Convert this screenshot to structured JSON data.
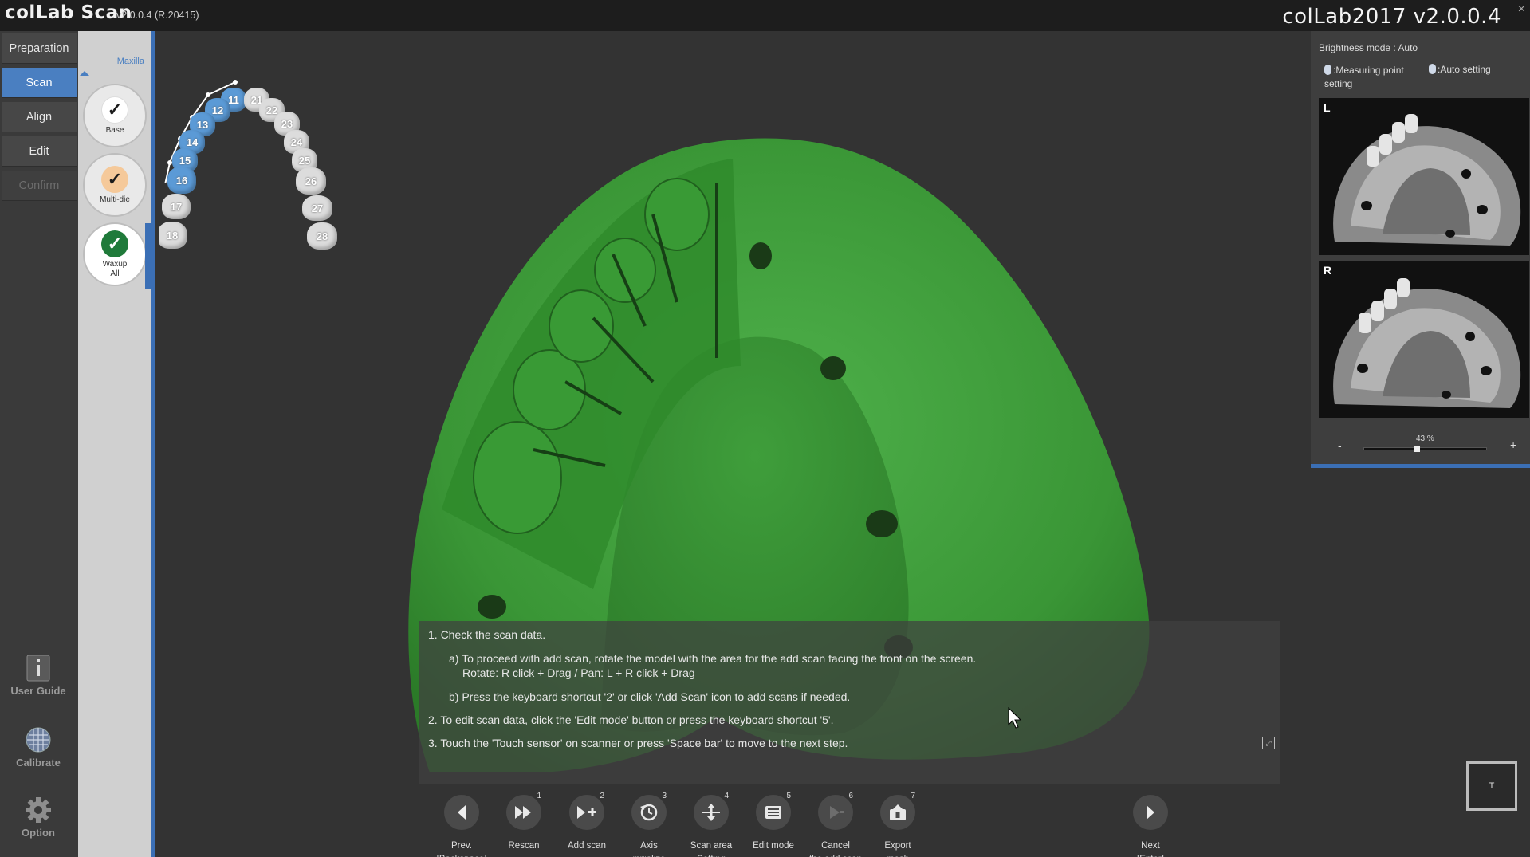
{
  "titlebar": {
    "app_name": "colLab Scan",
    "version": "v2.0.0.4 (R.20415)",
    "brand": "colLab2017 v2.0.0.4",
    "close": "×"
  },
  "leftnav": {
    "items": [
      {
        "label": "Preparation",
        "state": "normal"
      },
      {
        "label": "Scan",
        "state": "active"
      },
      {
        "label": "Align",
        "state": "normal"
      },
      {
        "label": "Edit",
        "state": "normal"
      },
      {
        "label": "Confirm",
        "state": "disabled"
      }
    ],
    "user_guide": "User Guide",
    "calibrate": "Calibrate",
    "option": "Option"
  },
  "stages": {
    "jaw": "Maxilla",
    "items": [
      {
        "label": "Base",
        "status": "done"
      },
      {
        "label": "Multi-die",
        "status": "done"
      },
      {
        "label": "Waxup\nAll",
        "status": "current"
      }
    ]
  },
  "tooth_chart": {
    "teeth": [
      "11",
      "12",
      "13",
      "14",
      "15",
      "16",
      "17",
      "18",
      "21",
      "22",
      "23",
      "24",
      "25",
      "26",
      "27",
      "28"
    ],
    "selected": [
      "11",
      "12",
      "13",
      "14",
      "15",
      "16"
    ]
  },
  "instructions": {
    "step1": "1. Check the scan data.",
    "step1a": "a) To proceed with add scan, rotate the model with the area for the add scan facing the front on the screen.",
    "step1a_hint": "Rotate: R click + Drag / Pan: L + R click + Drag",
    "step1b": "b) Press the keyboard shortcut '2' or click 'Add Scan' icon to add scans if needed.",
    "step2": "2. To edit scan data, click the 'Edit mode' button or press the keyboard shortcut '5'.",
    "step3": "3. Touch the 'Touch sensor' on scanner or press 'Space bar' to move to the next step."
  },
  "toolbar": {
    "prev": {
      "label": "Prev.\n[Backspace]",
      "icon": "chevron-left-icon"
    },
    "tools": [
      {
        "label": "Rescan",
        "key": "1",
        "icon": "rescan-icon",
        "glyph": "⏩"
      },
      {
        "label": "Add scan",
        "key": "2",
        "icon": "add-scan-icon",
        "glyph": "▶+"
      },
      {
        "label": "Axis\ninitialize",
        "key": "3",
        "icon": "axis-reset-icon",
        "glyph": "⟲"
      },
      {
        "label": "Scan area\nSetting",
        "key": "4",
        "icon": "scan-area-icon",
        "glyph": "↕"
      },
      {
        "label": "Edit mode",
        "key": "5",
        "icon": "edit-mode-icon",
        "glyph": "▦"
      },
      {
        "label": "Cancel\nthe add scan",
        "key": "6",
        "icon": "cancel-add-scan-icon",
        "glyph": "▶"
      },
      {
        "label": "Export\nmesh",
        "key": "7",
        "icon": "export-mesh-icon",
        "glyph": "⌂"
      }
    ],
    "next": {
      "label": "Next\n[Enter]",
      "icon": "chevron-right-icon"
    }
  },
  "right_panel": {
    "brightness_mode": "Brightness mode : Auto",
    "measuring_point": ":Measuring point setting",
    "auto_setting": ":Auto setting",
    "camera_left": "L",
    "camera_right": "R",
    "zoom": "43 %",
    "zoom_value": 0.43,
    "zoom_minus": "-",
    "zoom_plus": "+"
  },
  "corner_button": "T",
  "colors": {
    "accent": "#4a7fc1",
    "scan_green": "#3f9a3a",
    "tooth_selected": "#5b9ad6"
  }
}
